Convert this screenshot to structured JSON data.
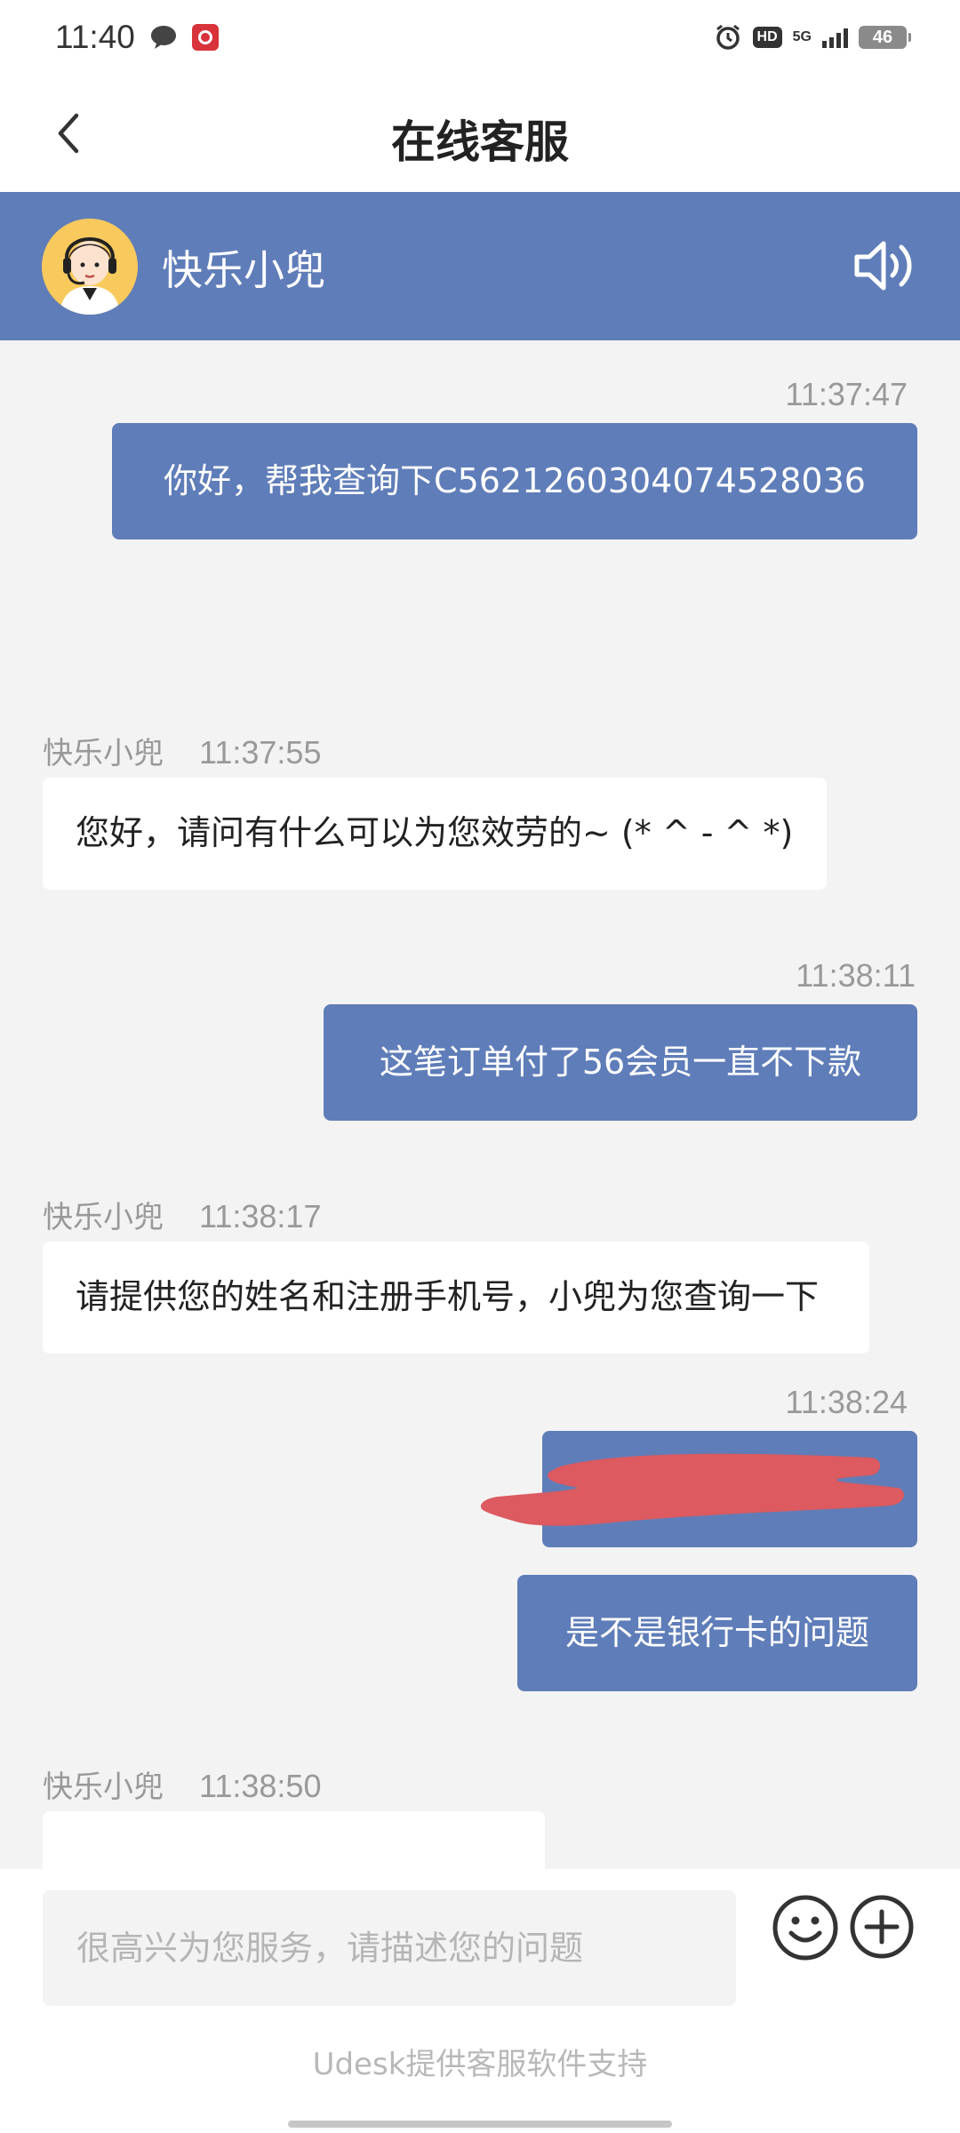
{
  "status_bar": {
    "time": "11:40",
    "network": "5G",
    "hd_label": "HD",
    "battery": "46"
  },
  "nav": {
    "title": "在线客服"
  },
  "agent": {
    "name": "快乐小兜"
  },
  "messages": [
    {
      "direction": "out",
      "time": "11:37:47",
      "text": "你好，帮我查询下C5621260304074528036"
    },
    {
      "direction": "in",
      "sender": "快乐小兜",
      "time": "11:37:55",
      "text": "您好，请问有什么可以为您效劳的~ (* ^ - ^ *)"
    },
    {
      "direction": "out",
      "time": "11:38:11",
      "text": "这笔订单付了56会员一直不下款"
    },
    {
      "direction": "in",
      "sender": "快乐小兜",
      "time": "11:38:17",
      "text": "请提供您的姓名和注册手机号，小兜为您查询一下"
    },
    {
      "direction": "out",
      "time": "11:38:24",
      "text": "",
      "redacted": true
    },
    {
      "direction": "out",
      "text": "是不是银行卡的问题"
    },
    {
      "direction": "in",
      "sender": "快乐小兜",
      "time": "11:38:50",
      "text": ""
    }
  ],
  "input": {
    "placeholder": "很高兴为您服务，请描述您的问题",
    "value": ""
  },
  "footer": {
    "powered_by": "Udesk提供客服软件支持"
  },
  "colors": {
    "accent": "#5f7db8",
    "chat_background": "#f3f3f3",
    "redaction": "#dc5a60"
  }
}
